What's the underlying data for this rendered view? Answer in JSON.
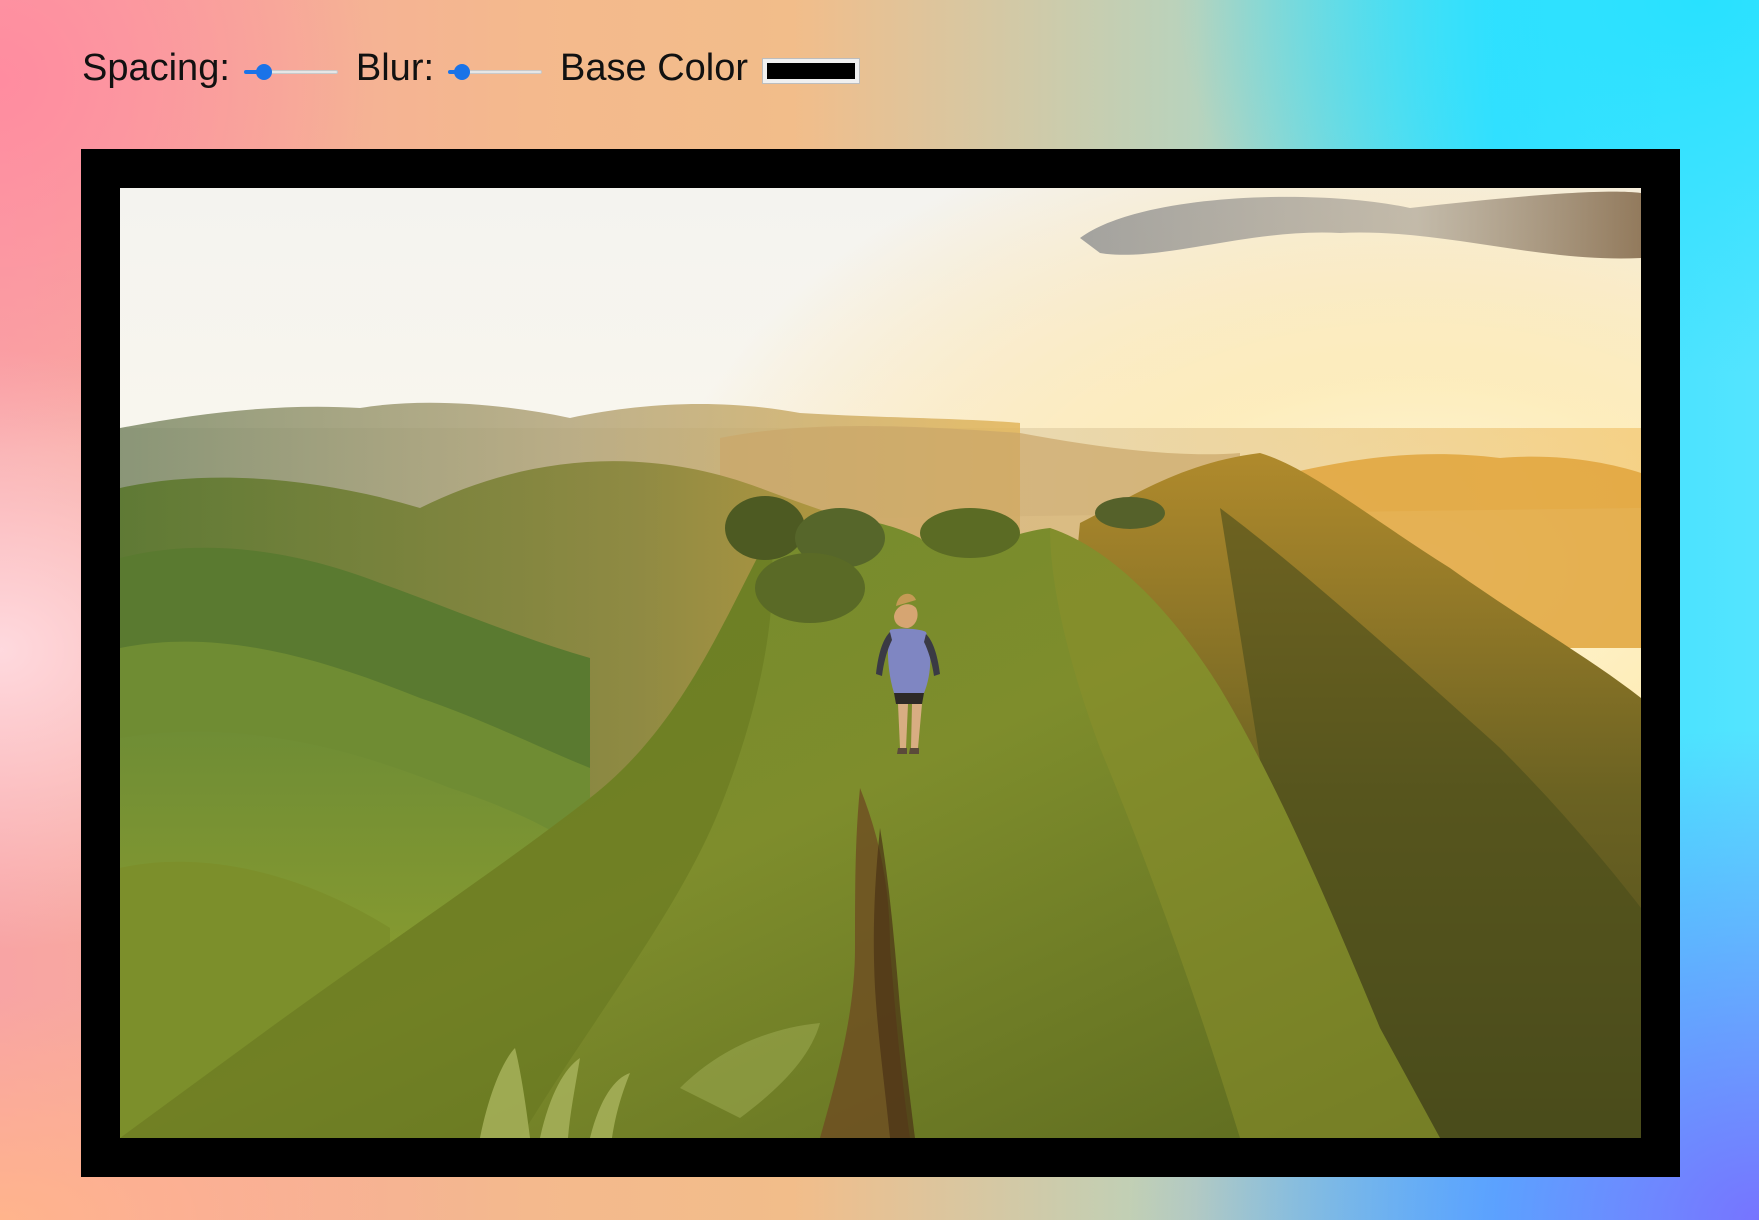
{
  "controls": {
    "spacing": {
      "label": "Spacing:",
      "value": 0.15
    },
    "blur": {
      "label": "Blur:",
      "value": 0.08
    },
    "base_color": {
      "label": "Base Color",
      "value": "#000000"
    }
  },
  "image": {
    "alt": "Hiker walking along a grassy mountain ridge at sunrise",
    "frame_color": "#000000"
  }
}
